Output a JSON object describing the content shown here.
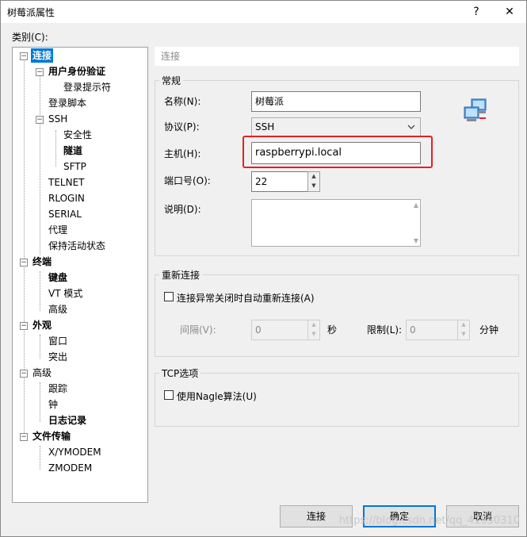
{
  "window": {
    "title": "树莓派属性",
    "help": "?",
    "close": "✕"
  },
  "category_label": "类别(C):",
  "tree": {
    "connect": "连接",
    "auth": "用户身份验证",
    "login_prompt": "登录提示符",
    "login_script": "登录脚本",
    "ssh": "SSH",
    "security": "安全性",
    "tunnel": "隧道",
    "sftp": "SFTP",
    "telnet": "TELNET",
    "rlogin": "RLOGIN",
    "serial": "SERIAL",
    "proxy": "代理",
    "keepalive": "保持活动状态",
    "terminal": "终端",
    "keyboard": "键盘",
    "vt_mode": "VT 模式",
    "advanced_t": "高级",
    "appearance": "外观",
    "window": "窗口",
    "highlight": "突出",
    "advanced": "高级",
    "trace": "跟踪",
    "bell": "钟",
    "logging": "日志记录",
    "file_transfer": "文件传输",
    "xymodem": "X/YMODEM",
    "zmodem": "ZMODEM"
  },
  "panel_header": "连接",
  "general": {
    "title": "常规",
    "name_label": "名称(N):",
    "name_value": "树莓派",
    "protocol_label": "协议(P):",
    "protocol_value": "SSH",
    "host_label": "主机(H):",
    "host_value": "raspberrypi.local",
    "port_label": "端口号(O):",
    "port_value": "22",
    "desc_label": "说明(D):"
  },
  "reconnect": {
    "title": "重新连接",
    "checkbox_label": "连接异常关闭时自动重新连接(A)",
    "interval_label": "间隔(V):",
    "interval_value": "0",
    "sec_label": "秒",
    "limit_label": "限制(L):",
    "limit_value": "0",
    "min_label": "分钟"
  },
  "tcp": {
    "title": "TCP选项",
    "nagle_label": "使用Nagle算法(U)"
  },
  "buttons": {
    "connect": "连接",
    "ok": "确定",
    "cancel": "取消"
  },
  "watermark": "https://blog.csdn.net/qq_41530310",
  "colors": {
    "selection": "#0078d7",
    "highlight_box": "#e62020"
  }
}
